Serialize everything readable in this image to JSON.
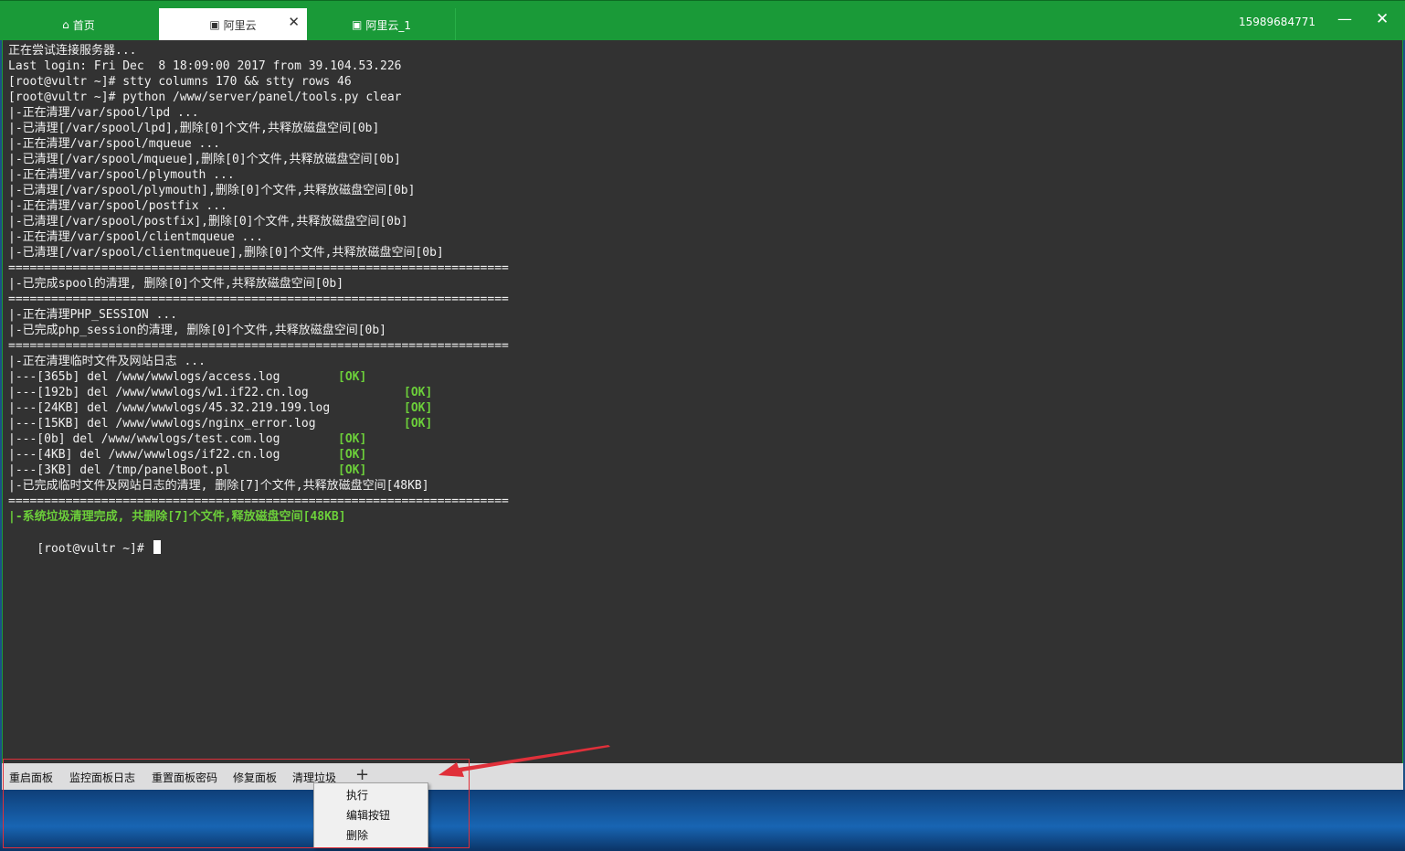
{
  "titlebar": {
    "tabs": [
      {
        "icon": "home-icon",
        "label": "首页"
      },
      {
        "icon": "terminal-icon",
        "label": "阿里云"
      },
      {
        "icon": "terminal-icon",
        "label": "阿里云_1"
      }
    ],
    "close_tab_glyph": "✕",
    "phone": "15989684771",
    "minimize_glyph": "—",
    "close_glyph": "✕"
  },
  "terminal": {
    "lines": [
      "正在尝试连接服务器...",
      "Last login: Fri Dec  8 18:09:00 2017 from 39.104.53.226",
      "[root@vultr ~]# stty columns 170 && stty rows 46",
      "[root@vultr ~]# python /www/server/panel/tools.py clear",
      "|-正在清理/var/spool/lpd ...",
      "|-已清理[/var/spool/lpd],删除[0]个文件,共释放磁盘空间[0b]",
      "|-正在清理/var/spool/mqueue ...",
      "|-已清理[/var/spool/mqueue],删除[0]个文件,共释放磁盘空间[0b]",
      "|-正在清理/var/spool/plymouth ...",
      "|-已清理[/var/spool/plymouth],删除[0]个文件,共释放磁盘空间[0b]",
      "|-正在清理/var/spool/postfix ...",
      "|-已清理[/var/spool/postfix],删除[0]个文件,共释放磁盘空间[0b]",
      "|-正在清理/var/spool/clientmqueue ...",
      "|-已清理[/var/spool/clientmqueue],删除[0]个文件,共释放磁盘空间[0b]",
      "======================================================================",
      "|-已完成spool的清理, 删除[0]个文件,共释放磁盘空间[0b]",
      "======================================================================",
      "|-正在清理PHP_SESSION ...",
      "|-已完成php_session的清理, 删除[0]个文件,共释放磁盘空间[0b]",
      "======================================================================",
      "|-正在清理临时文件及网站日志 ...",
      "|---[365b] del /www/wwwlogs/access.log",
      "|---[192b] del /www/wwwlogs/w1.if22.cn.log",
      "|---[24KB] del /www/wwwlogs/45.32.219.199.log",
      "|---[15KB] del /www/wwwlogs/nginx_error.log",
      "|---[0b] del /www/wwwlogs/test.com.log",
      "|---[4KB] del /www/wwwlogs/if22.cn.log",
      "|---[3KB] del /tmp/panelBoot.pl",
      "|-已完成临时文件及网站日志的清理, 删除[7]个文件,共释放磁盘空间[48KB]",
      "======================================================================",
      "|-系统垃圾清理完成, 共删除[7]个文件,释放磁盘空间[48KB]",
      "[root@vultr ~]# "
    ],
    "ok_label": "[OK]"
  },
  "toolbar": {
    "buttons": [
      "重启面板",
      "监控面板日志",
      "重置面板密码",
      "修复面板",
      "清理垃圾"
    ],
    "plus": "+"
  },
  "context_menu": {
    "items": [
      "执行",
      "编辑按钮",
      "删除"
    ]
  },
  "colors": {
    "title_green": "#1a9a38",
    "terminal_bg": "#323232",
    "ok_green": "#6ccf3a",
    "highlight_red": "#e0303a"
  }
}
